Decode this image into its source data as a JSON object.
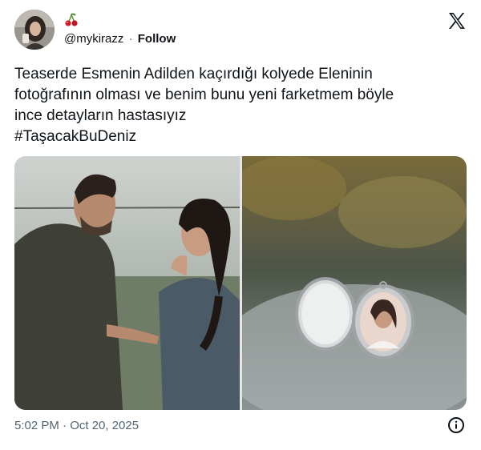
{
  "header": {
    "display_name": "",
    "display_name_icon": "cherry-emoji",
    "handle": "@mykirazz",
    "separator": "·",
    "follow_label": "Follow",
    "platform_icon": "x-logo-icon"
  },
  "tweet": {
    "text": "Teaserde Esmenin Adilden kaçırdığı kolyede Eleninin\nfotoğrafının olması ve benim bunu yeni farketmem böyle\nince detayların hastasıyız\n#TaşacakBuDeniz"
  },
  "media": {
    "images": [
      {
        "description_icon": "photo-couple"
      },
      {
        "description_icon": "photo-locket"
      }
    ]
  },
  "footer": {
    "timestamp": "5:02 PM · Oct 20, 2025",
    "info_icon": "info-icon"
  }
}
